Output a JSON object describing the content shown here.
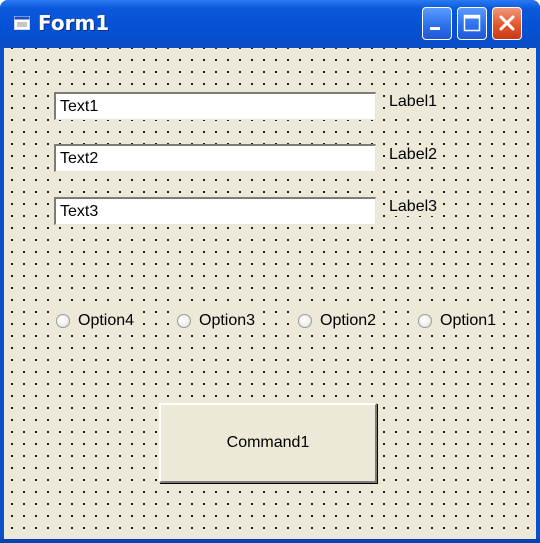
{
  "window": {
    "title": "Form1",
    "colors": {
      "titlebar": "#0551d4",
      "client": "#ece9d8",
      "close_button": "#e2562f"
    }
  },
  "textboxes": [
    {
      "value": "Text1"
    },
    {
      "value": "Text2"
    },
    {
      "value": "Text3"
    }
  ],
  "labels": [
    "Label1",
    "Label2",
    "Label3"
  ],
  "options": [
    "Option4",
    "Option3",
    "Option2",
    "Option1"
  ],
  "command": {
    "label": "Command1"
  }
}
